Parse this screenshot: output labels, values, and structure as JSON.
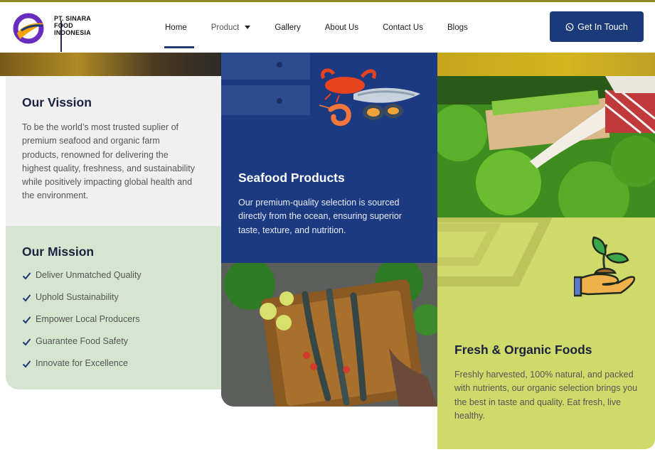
{
  "brand": {
    "line1": "PT. SINARA",
    "line2": "FOOD",
    "line3": "INDONESIA",
    "colors": {
      "navy": "#1b3a7a",
      "purple": "#6a2bbf",
      "orange": "#f5a300"
    }
  },
  "nav": {
    "items": [
      {
        "label": "Home",
        "active": true
      },
      {
        "label": "Product",
        "dropdown": true
      },
      {
        "label": "Gallery"
      },
      {
        "label": "About Us"
      },
      {
        "label": "Contact Us"
      },
      {
        "label": "Blogs"
      }
    ],
    "cta_label": "Get In Touch",
    "cta_icon": "whatsapp-icon"
  },
  "vision": {
    "title": "Our Vission",
    "body": "To be the world’s most trusted suplier of premium seafood and organic farm products, renowned for delivering the highest quality, freshness, and sustainability while positively impacting global health and the environment."
  },
  "mission": {
    "title": "Our Mission",
    "items": [
      "Deliver Unmatched Quality",
      "Uphold Sustainability",
      "Empower Local Producers",
      "Guarantee Food Safety",
      "Innovate for Excellence"
    ]
  },
  "seafood": {
    "title": "Seafood Products",
    "body": "Our premium-quality selection is sourced directly from the ocean, ensuring superior taste, texture, and nutrition.",
    "icon": "seafood-illustration"
  },
  "organic": {
    "title": "Fresh & Organic Foods",
    "body": "Freshly harvested, 100% natural, and packed with nutrients, our organic selection brings you the best in taste and quality. Eat fresh, live healthy.",
    "icon": "plant-in-hand-icon"
  }
}
